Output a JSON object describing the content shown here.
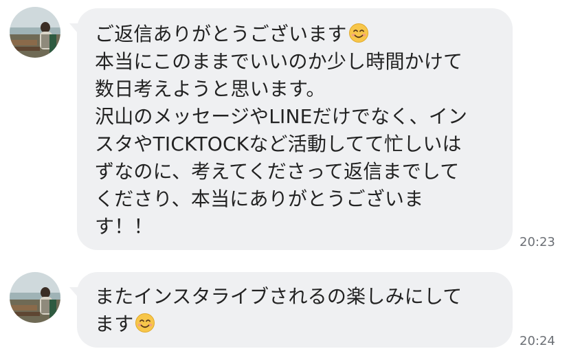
{
  "messages": [
    {
      "lines": [
        "ご返信ありがとうございます",
        "本当にこのままでいいのか少し時間かけて",
        "数日考えようと思います。",
        "沢山のメッセージやLINEだけでなく、イン",
        "スタやTICKTOCKなど活動してて忙しいは",
        "ずなのに、考えてくださって返信までして",
        "くださり、本当にありがとうございま",
        "す！！"
      ],
      "emoji": "smiling-face-emoji",
      "time": "20:23"
    },
    {
      "lines": [
        "またインスタライブされるの楽しみにして",
        "ます"
      ],
      "emoji": "smiling-face-emoji",
      "time": "20:24"
    }
  ],
  "colors": {
    "bubble": "#eff0f2",
    "text": "#222222",
    "timestamp": "#6b6f75"
  }
}
